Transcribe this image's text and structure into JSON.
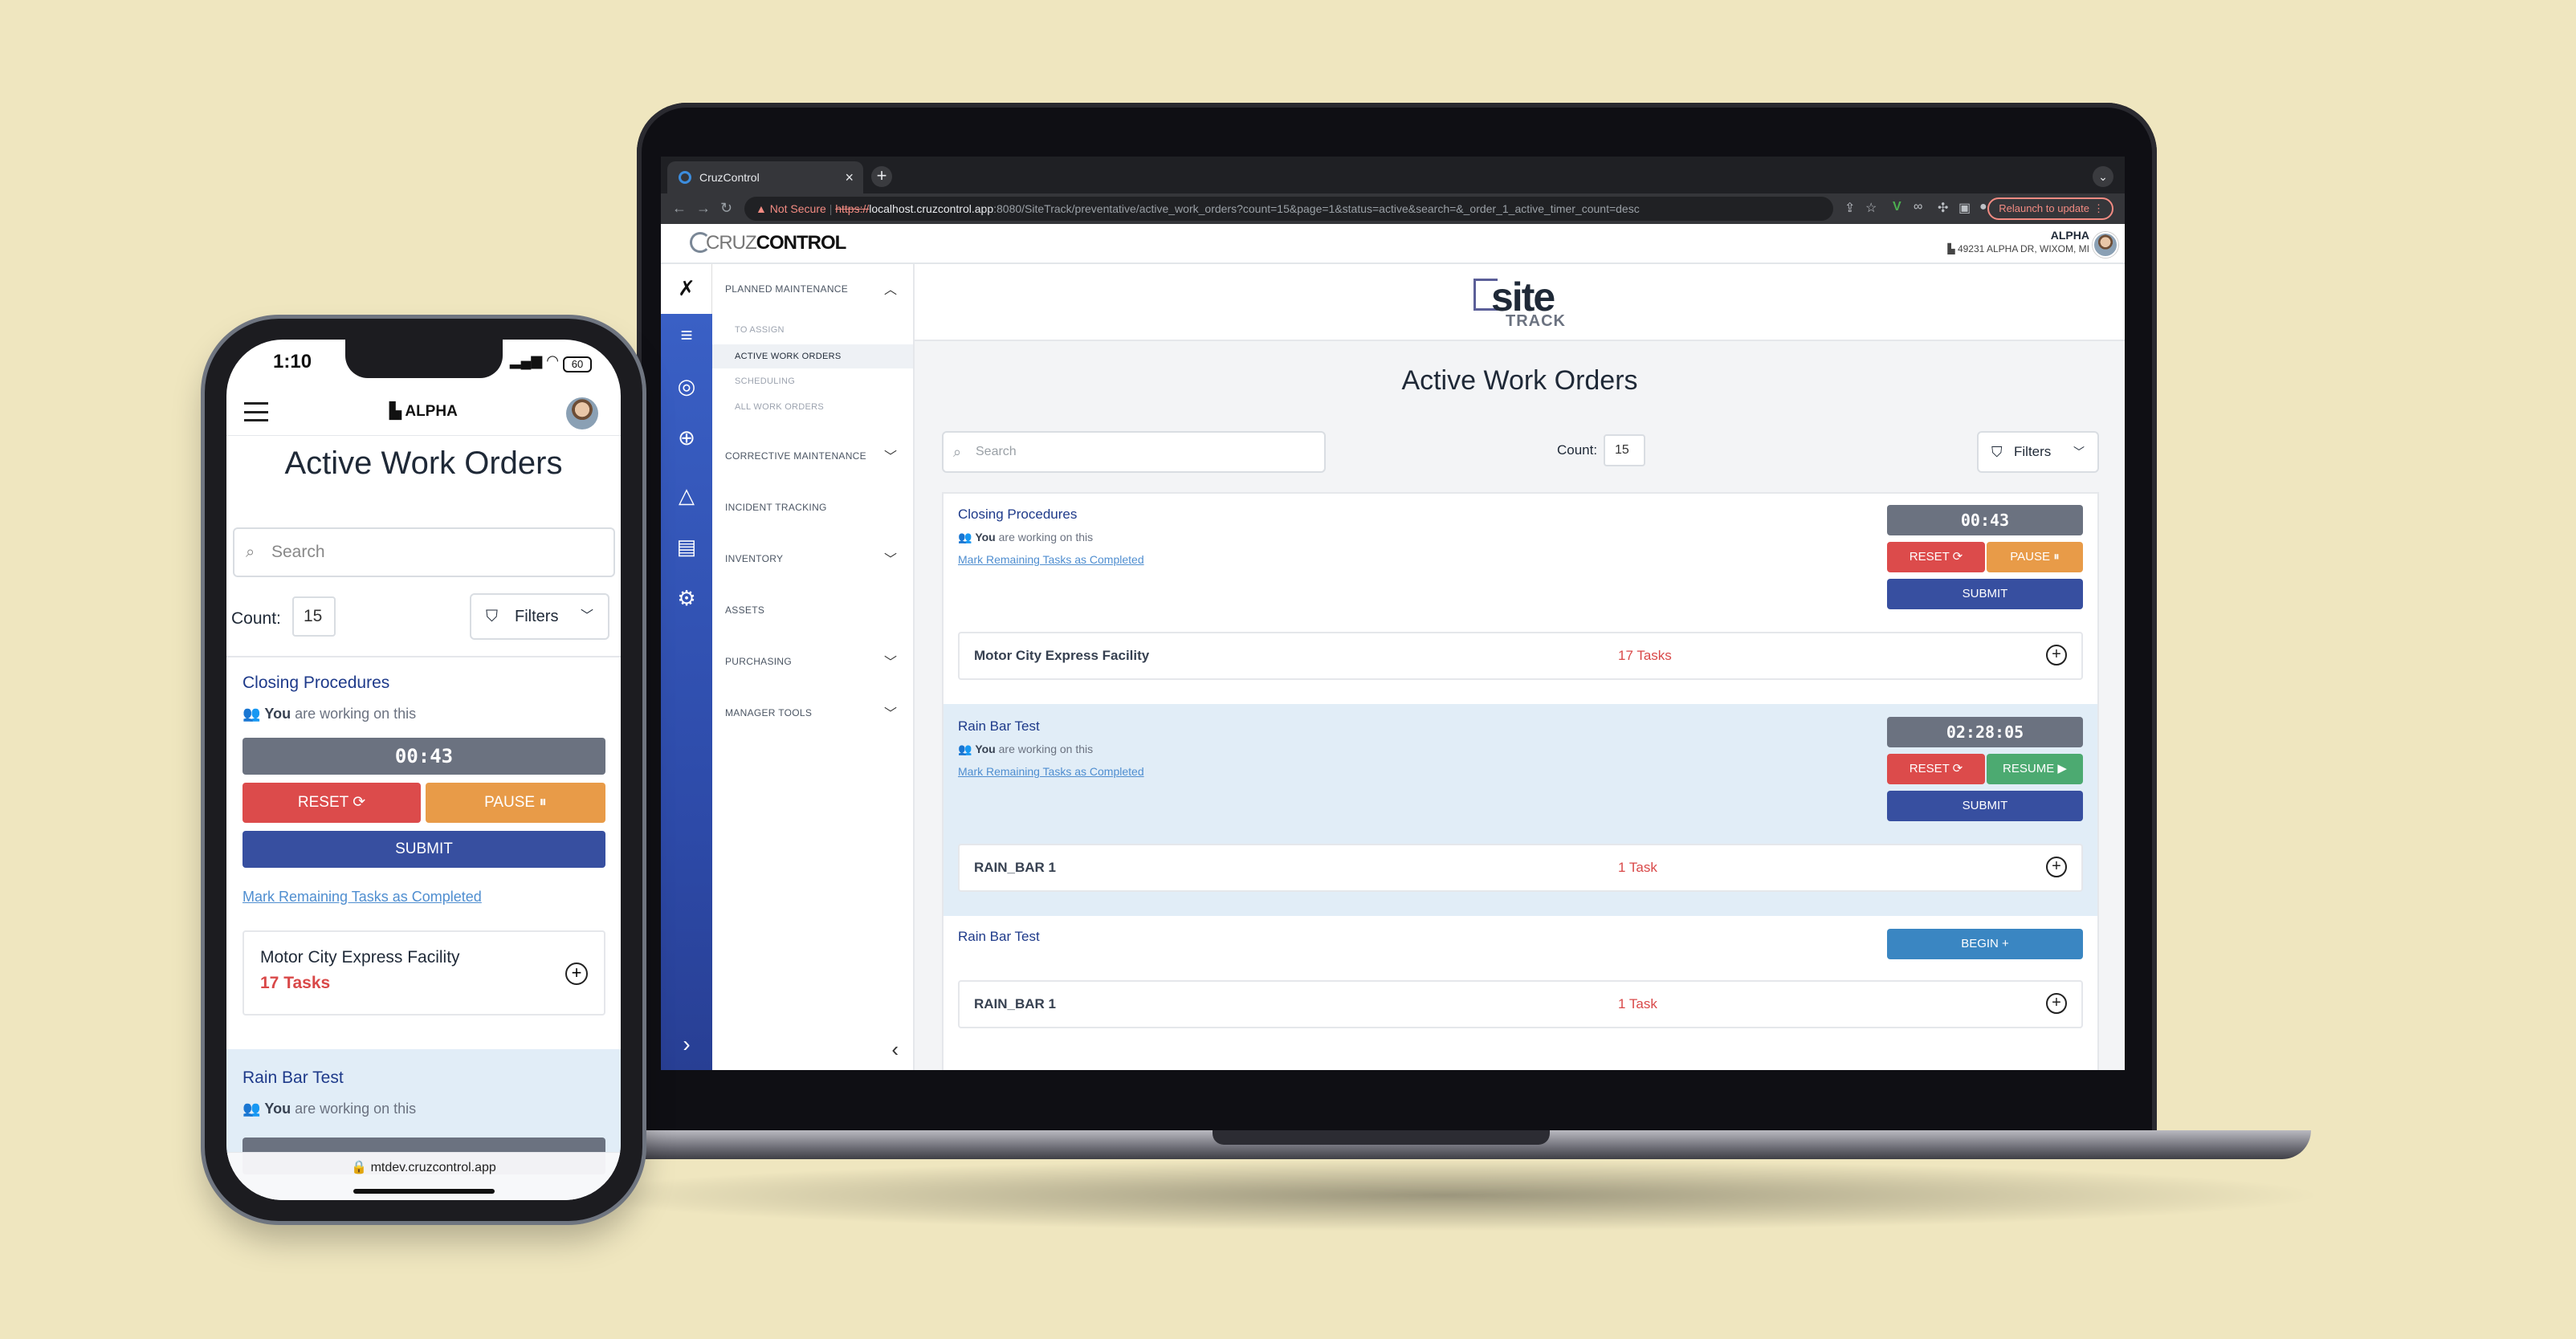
{
  "browser": {
    "tab_title": "CruzControl",
    "url_warning": "Not Secure",
    "url_scheme": "https://",
    "url_host": "localhost.cruzcontrol.app",
    "url_path": ":8080/SiteTrack/preventative/active_work_orders?count=15&page=1&status=active&search=&_order_1_active_timer_count=desc",
    "relaunch_label": "Relaunch to update"
  },
  "app": {
    "logo_light": "CRUZ",
    "logo_bold": "CONTROL",
    "user_name": "ALPHA",
    "user_address": "49231 ALPHA DR, WIXOM, MI",
    "site_logo_main": "site",
    "site_logo_sub": "TRACK"
  },
  "sidebar": {
    "planned_maintenance": "PLANNED MAINTENANCE",
    "sub_items": [
      "TO ASSIGN",
      "ACTIVE WORK ORDERS",
      "SCHEDULING",
      "ALL WORK ORDERS"
    ],
    "corrective_maintenance": "CORRECTIVE MAINTENANCE",
    "incident_tracking": "INCIDENT TRACKING",
    "inventory": "INVENTORY",
    "assets": "ASSETS",
    "purchasing": "PURCHASING",
    "manager_tools": "MANAGER TOOLS"
  },
  "main": {
    "title": "Active Work Orders",
    "search_placeholder": "Search",
    "count_label": "Count:",
    "count_value": "15",
    "filters_label": "Filters",
    "working_you": "You",
    "working_rest": "are working on this",
    "mark_remaining": "Mark Remaining Tasks as Completed",
    "reset_label": "RESET",
    "pause_label": "PAUSE",
    "resume_label": "RESUME",
    "submit_label": "SUBMIT",
    "begin_label": "BEGIN",
    "work_orders": [
      {
        "title": "Closing Procedures",
        "timer": "00:43",
        "facility": "Motor City Express Facility",
        "tasks": "17 Tasks"
      },
      {
        "title": "Rain Bar Test",
        "timer": "02:28:05",
        "facility": "RAIN_BAR 1",
        "tasks": "1 Task"
      },
      {
        "title": "Rain Bar Test",
        "facility": "RAIN_BAR 1",
        "tasks": "1 Task"
      }
    ]
  },
  "phone": {
    "time": "1:10",
    "battery": "60",
    "brand": "ALPHA",
    "title": "Active Work Orders",
    "search_placeholder": "Search",
    "count_label": "Count:",
    "count_value": "15",
    "filters_label": "Filters",
    "card1_title": "Closing Procedures",
    "working_you": "You",
    "working_rest": "are working on this",
    "timer": "00:43",
    "reset_label": "RESET",
    "pause_label": "PAUSE",
    "submit_label": "SUBMIT",
    "mark_remaining": "Mark Remaining Tasks as Completed",
    "facility": "Motor City Express Facility",
    "tasks": "17 Tasks",
    "card2_title": "Rain Bar Test",
    "url": "mtdev.cruzcontrol.app"
  },
  "colors": {
    "background": "#efe6bf",
    "rail": "#2d4aa8",
    "reset": "#dc4b4b",
    "pause": "#e89b48",
    "resume": "#4caa71",
    "submit": "#374fa0",
    "begin": "#3a86c2",
    "tasks": "#d94848"
  }
}
